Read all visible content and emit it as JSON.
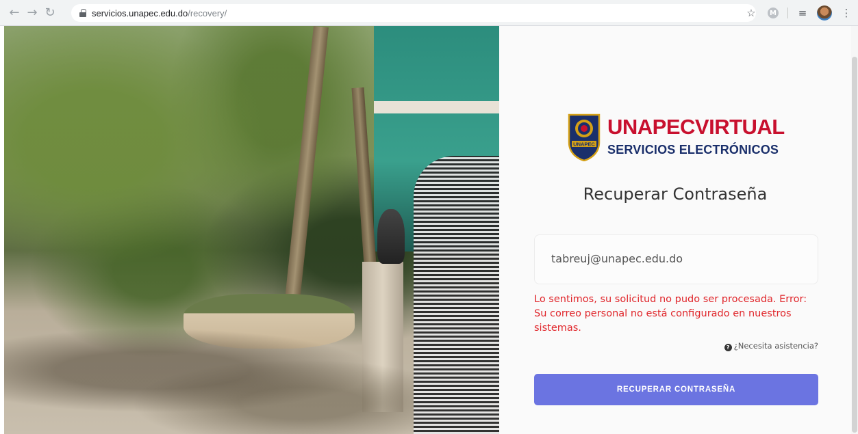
{
  "browser": {
    "url_host": "servicios.unapec.edu.do",
    "url_path": "/recovery/",
    "icons": [
      "back-icon",
      "forward-icon",
      "reload-icon",
      "lock-icon",
      "star-icon",
      "extension-icon",
      "reading-list-icon",
      "profile-avatar",
      "menu-icon"
    ],
    "extension_letter": "M"
  },
  "brand": {
    "name": "UNAPECVIRTUAL",
    "subtitle": "SERVICIOS ELECTRÓNICOS",
    "shield_text": "UNAPEC",
    "colors": {
      "red": "#c8102e",
      "navy": "#1a2f6b",
      "gold": "#d4a017"
    }
  },
  "form": {
    "title": "Recuperar Contraseña",
    "email_value": "tabreuj@unapec.edu.do",
    "error_message": "Lo sentimos, su solicitud no pudo ser procesada. Error: Su correo personal no está configurado en nuestros sistemas.",
    "help_link": "¿Necesita asistencia?",
    "submit_label": "RECUPERAR CONTRASEÑA",
    "accent_color": "#6b74e1",
    "error_color": "#e0262b"
  }
}
